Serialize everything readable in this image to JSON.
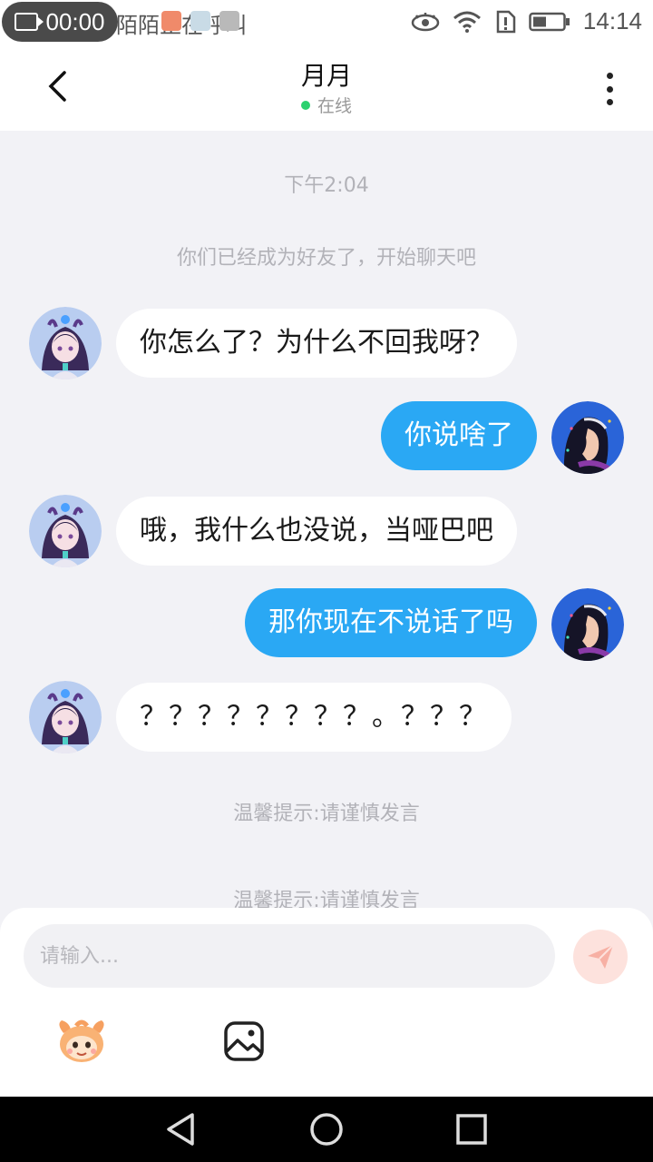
{
  "status_bar": {
    "record_time": "00:00",
    "background_text": "陌陌正在呼叫",
    "clock": "14:14"
  },
  "header": {
    "title": "月月",
    "status": "在线",
    "status_color": "#2bd16e"
  },
  "chat": {
    "timestamp": "下午2:04",
    "system_notice": "你们已经成为好友了，开始聊天吧",
    "messages": [
      {
        "side": "in",
        "text": "你怎么了？为什么不回我呀？"
      },
      {
        "side": "out",
        "text": "你说啥了"
      },
      {
        "side": "in",
        "text": "哦，我什么也没说，当哑巴吧"
      },
      {
        "side": "out",
        "text": "那你现在不说话了吗"
      },
      {
        "side": "in",
        "text": "？？？？？？？？。？？？"
      }
    ],
    "tips": [
      "温馨提示:请谨慎发言",
      "温馨提示:请谨慎发言"
    ],
    "outgoing_bubble_color": "#2aa8f4"
  },
  "composer": {
    "placeholder": "请输入...",
    "send_icon": "paper-plane-icon",
    "tools": [
      "mascot-emoji-icon",
      "image-icon"
    ]
  },
  "nav": {
    "buttons": [
      "back-triangle-icon",
      "home-circle-icon",
      "recents-square-icon"
    ]
  }
}
